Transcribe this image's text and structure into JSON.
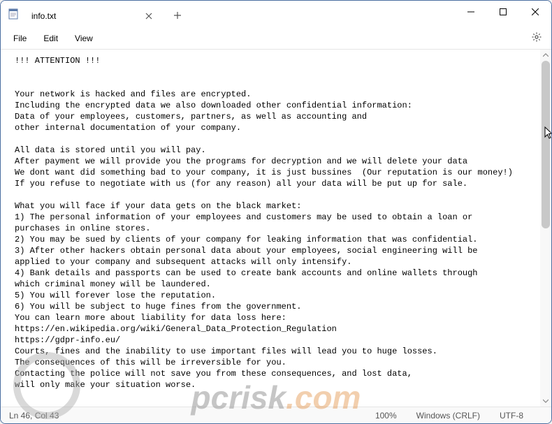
{
  "window": {
    "tab_title": "info.txt"
  },
  "menubar": {
    "file": "File",
    "edit": "Edit",
    "view": "View"
  },
  "content": "!!! ATTENTION !!!\n\n\nYour network is hacked and files are encrypted.\nIncluding the encrypted data we also downloaded other confidential information:\nData of your employees, customers, partners, as well as accounting and\nother internal documentation of your company.\n\nAll data is stored until you will pay.\nAfter payment we will provide you the programs for decryption and we will delete your data\nWe dont want did something bad to your company, it is just bussines  (Our reputation is our money!)\nIf you refuse to negotiate with us (for any reason) all your data will be put up for sale.\n\nWhat you will face if your data gets on the black market:\n1) The personal information of your employees and customers may be used to obtain a loan or\npurchases in online stores.\n2) You may be sued by clients of your company for leaking information that was confidential.\n3) After other hackers obtain personal data about your employees, social engineering will be\napplied to your company and subsequent attacks will only intensify.\n4) Bank details and passports can be used to create bank accounts and online wallets through\nwhich criminal money will be laundered.\n5) You will forever lose the reputation.\n6) You will be subject to huge fines from the government.\nYou can learn more about liability for data loss here:\nhttps://en.wikipedia.org/wiki/General_Data_Protection_Regulation\nhttps://gdpr-info.eu/\nCourts, fines and the inability to use important files will lead you to huge losses.\nThe consequences of this will be irreversible for you.\nContacting the police will not save you from these consequences, and lost data,\nwill only make your situation worse.",
  "statusbar": {
    "cursor": "Ln 46, Col 43",
    "zoom": "100%",
    "line_endings": "Windows (CRLF)",
    "encoding": "UTF-8"
  },
  "watermark": {
    "prefix": "pcrisk",
    "suffix": ".com"
  }
}
